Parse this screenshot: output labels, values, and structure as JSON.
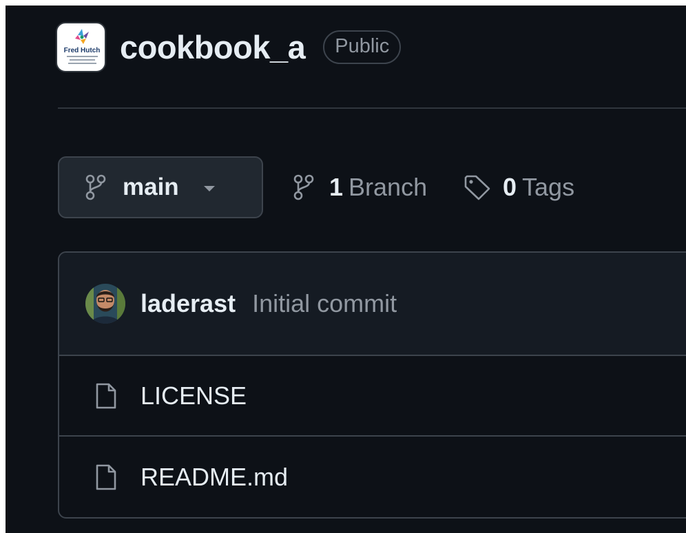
{
  "repo": {
    "name": "cookbook_a",
    "visibility": "Public",
    "logo_icon": "org-logo-fred-hutch",
    "logo_text": "Fred Hutch"
  },
  "branches": {
    "current": "main",
    "count": "1",
    "count_label": "Branch"
  },
  "tags": {
    "count": "0",
    "count_label": "Tags"
  },
  "latest_commit": {
    "author": "laderast",
    "message": "Initial commit"
  },
  "files": [
    {
      "name": "LICENSE",
      "icon": "file-icon"
    },
    {
      "name": "README.md",
      "icon": "file-icon"
    }
  ],
  "colors": {
    "background": "#0d1117",
    "text_primary": "#e6edf3",
    "text_muted": "#9198a1",
    "border": "#3d444d"
  }
}
